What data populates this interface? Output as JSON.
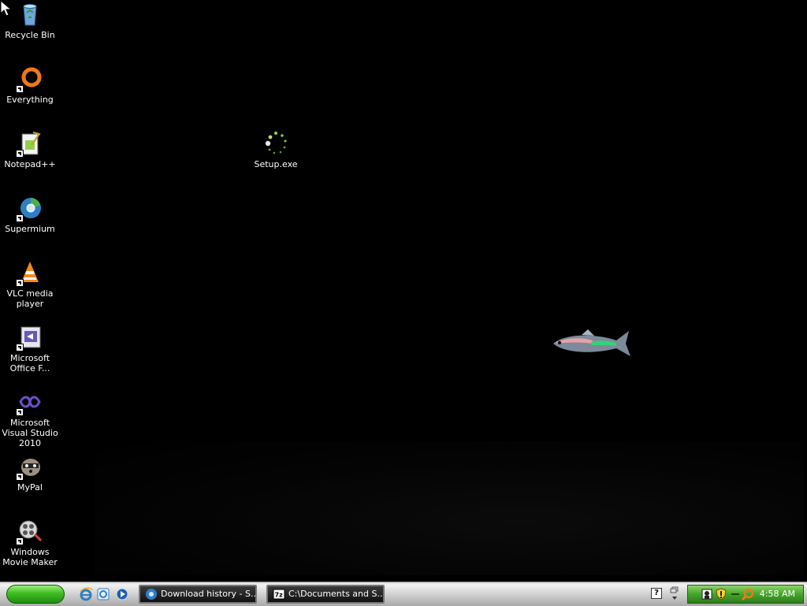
{
  "desktop": {
    "icons": [
      {
        "label": "Recycle Bin",
        "icon": "recycle-bin-icon"
      },
      {
        "label": "Everything",
        "icon": "everything-icon"
      },
      {
        "label": "Notepad++",
        "icon": "notepadpp-icon"
      },
      {
        "label": "Supermium",
        "icon": "supermium-icon"
      },
      {
        "label": "VLC media player",
        "icon": "vlc-icon"
      },
      {
        "label": "Microsoft Office F...",
        "icon": "office-icon"
      },
      {
        "label": "Microsoft Visual Studio 2010",
        "icon": "visual-studio-icon"
      },
      {
        "label": "MyPal",
        "icon": "mypal-icon"
      },
      {
        "label": "Windows Movie Maker",
        "icon": "movie-maker-icon"
      }
    ],
    "setup": {
      "label": "Setup.exe",
      "icon": "setup-loading-icon"
    }
  },
  "taskbar": {
    "quick_launch": [
      "internet-explorer-icon",
      "ie-alt-icon",
      "media-player-icon"
    ],
    "tasks": [
      {
        "label": "Download history - S...",
        "icon": "supermium-icon"
      },
      {
        "label": "C:\\Documents and S...",
        "icon": "7zip-icon"
      }
    ],
    "help_glyph": "?",
    "tray": {
      "icons": [
        "network-icon",
        "security-shield-icon",
        "separator-icon",
        "search-icon"
      ],
      "time": "4:58 AM"
    }
  },
  "colors": {
    "desktop": "#000000",
    "start_green": "#3fbd22",
    "tray_green": "#44a52a"
  }
}
